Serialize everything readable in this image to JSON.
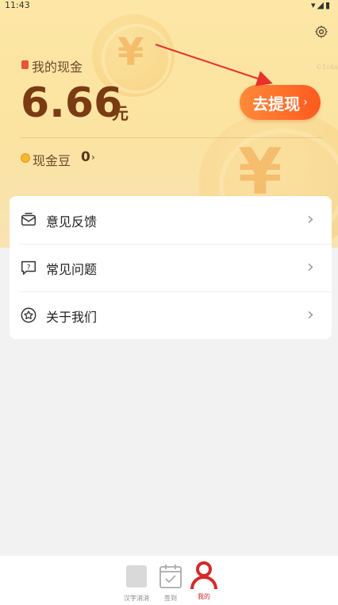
{
  "status_bar": {
    "time": "11:43"
  },
  "header": {
    "watermark": "©1c4a7",
    "cash_label": "我的现金",
    "amount": "6.66",
    "unit": "元",
    "withdraw_button": "去提现",
    "beans_label": "现金豆",
    "beans_value": "0"
  },
  "menu": {
    "items": [
      {
        "label": "意见反馈",
        "icon": "feedback-mail-icon"
      },
      {
        "label": "常见问题",
        "icon": "faq-chat-icon"
      },
      {
        "label": "关于我们",
        "icon": "about-star-icon"
      }
    ]
  },
  "tabbar": {
    "tabs": [
      {
        "label": "汉字消消",
        "icon": "puzzle-icon"
      },
      {
        "label": "签到",
        "icon": "calendar-check-icon"
      },
      {
        "label": "我的",
        "icon": "person-icon",
        "active": true
      }
    ]
  },
  "colors": {
    "accent": "#ff5a1f",
    "amount": "#7a3b12",
    "tab_active": "#d42a2a"
  }
}
